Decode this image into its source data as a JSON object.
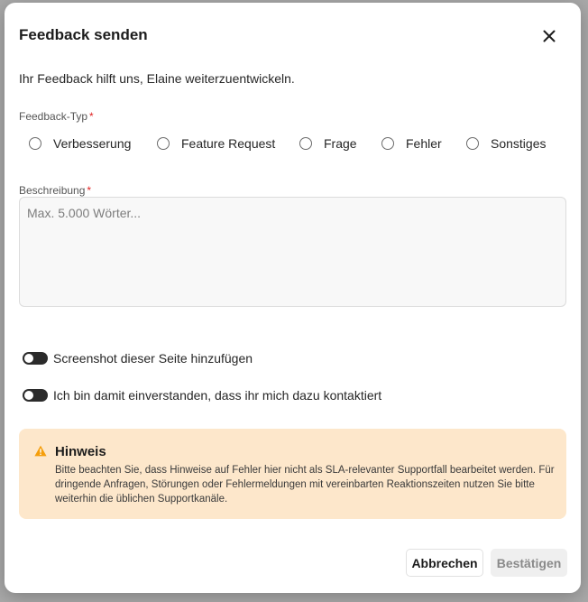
{
  "dialog": {
    "title": "Feedback senden",
    "intro": "Ihr Feedback hilft uns, Elaine weiterzuentwickeln."
  },
  "feedback_type": {
    "label": "Feedback-Typ",
    "required_mark": "*",
    "options": [
      {
        "label": "Verbesserung",
        "selected": false
      },
      {
        "label": "Feature Request",
        "selected": false
      },
      {
        "label": "Frage",
        "selected": false
      },
      {
        "label": "Fehler",
        "selected": false
      },
      {
        "label": "Sonstiges",
        "selected": false
      }
    ]
  },
  "description": {
    "label": "Beschreibung",
    "required_mark": "*",
    "placeholder": "Max. 5.000 Wörter...",
    "value": ""
  },
  "toggles": {
    "screenshot": {
      "label": "Screenshot dieser Seite hinzufügen",
      "on": false
    },
    "contact": {
      "label": "Ich bin damit einverstanden, dass ihr mich dazu kontaktiert",
      "on": false
    }
  },
  "notice": {
    "icon": "warning-icon",
    "title": "Hinweis",
    "text": "Bitte beachten Sie, dass Hinweise auf Fehler hier nicht als SLA-relevanter Supportfall bearbeitet werden. Für dringende Anfragen, Störungen oder Fehlermeldungen mit vereinbarten Reaktionszeiten nutzen Sie bitte weiterhin die üblichen Supportkanäle."
  },
  "buttons": {
    "cancel": "Abbrechen",
    "confirm": "Bestätigen"
  },
  "colors": {
    "notice_bg": "#fde7cb",
    "warning": "#f59e0b",
    "required": "#e02424",
    "toggle_off": "#2b2b2b"
  }
}
